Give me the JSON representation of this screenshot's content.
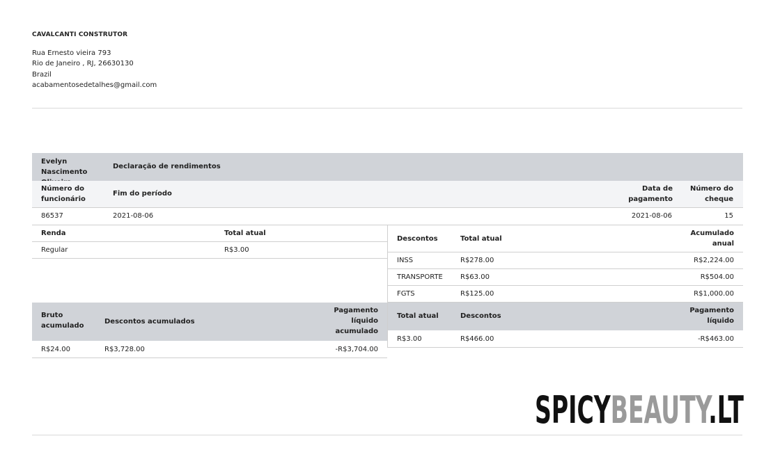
{
  "company": {
    "name": "CAVALCANTI CONSTRUTOR",
    "address_line1": "Rua Ernesto vieira 793",
    "address_line2": "Rio de Janeiro , RJ, 26630130",
    "country": "Brazil",
    "email": "acabamentosedetalhes@gmail.com"
  },
  "statement": {
    "employee_name": "Evelyn Nascimento Oliveira",
    "title": "Declaração de rendimentos",
    "headers": {
      "employee_number": "Número do funcionário",
      "period_end": "Fim do período",
      "payment_date": "Data de pagamento",
      "check_number": "Número do cheque"
    },
    "values": {
      "employee_number": "86537",
      "period_end": "2021-08-06",
      "payment_date": "2021-08-06",
      "check_number": "15"
    }
  },
  "income": {
    "headers": {
      "label": "Renda",
      "current": "Total atual"
    },
    "rows": [
      {
        "label": "Regular",
        "current": "R$3.00"
      }
    ]
  },
  "deductions": {
    "headers": {
      "label": "Descontos",
      "current": "Total atual",
      "ytd": "Acumulado anual"
    },
    "rows": [
      {
        "label": "INSS",
        "current": "R$278.00",
        "ytd": "R$2,224.00"
      },
      {
        "label": "TRANSPORTE",
        "current": "R$63.00",
        "ytd": "R$504.00"
      },
      {
        "label": "FGTS",
        "current": "R$125.00",
        "ytd": "R$1,000.00"
      }
    ]
  },
  "ytd_summary": {
    "headers": {
      "gross": "Bruto acumulado",
      "deductions": "Descontos acumulados",
      "net": "Pagamento líquido acumulado"
    },
    "values": {
      "gross": "R$24.00",
      "deductions": "R$3,728.00",
      "net": "-R$3,704.00"
    }
  },
  "current_summary": {
    "headers": {
      "total": "Total atual",
      "deductions": "Descontos",
      "net": "Pagamento líquido"
    },
    "values": {
      "total": "R$3.00",
      "deductions": "R$466.00",
      "net": "-R$463.00"
    }
  },
  "watermark": {
    "part1": "SPICY",
    "part2": "BEAUTY",
    "part3": ".LT",
    "color_dark": "#111111",
    "color_gray": "#9a9a9a"
  }
}
